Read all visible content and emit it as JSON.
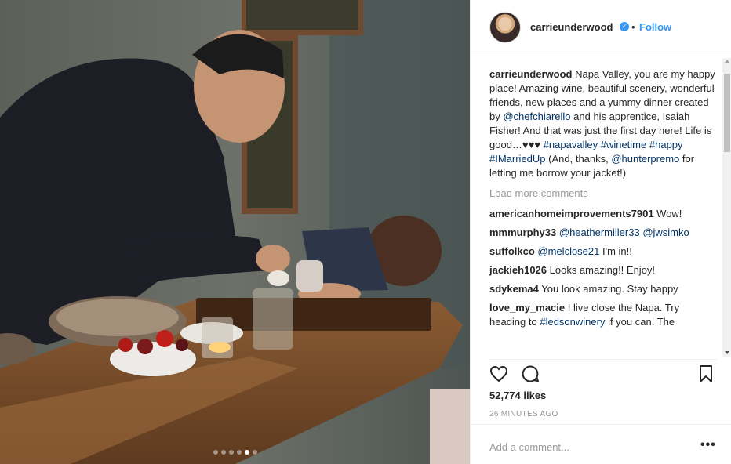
{
  "post": {
    "username": "carrieunderwood",
    "follow_label": "Follow",
    "bullet": "•",
    "verified_icon": "✓",
    "likes": "52,774 likes",
    "time": "26 MINUTES AGO",
    "add_comment_placeholder": "Add a comment...",
    "more_label": "•••",
    "carousel": {
      "count": 6,
      "active_index": 4
    }
  },
  "caption": {
    "user": "carrieunderwood",
    "t1": " Napa Valley, you are my happy place! Amazing wine, beautiful scenery, wonderful friends, new places and a yummy dinner created by ",
    "m1": "@chefchiarello",
    "t2": " and his apprentice, Isaiah Fisher! And that was just the first day here! Life is good…♥♥♥ ",
    "h1": "#napavalley",
    "s1": " ",
    "h2": "#winetime",
    "s2": " ",
    "h3": "#happy",
    "s3": " ",
    "h4": "#IMarriedUp",
    "t3": " (And, thanks, ",
    "m2": "@hunterpremo",
    "t4": " for letting me borrow your jacket!)"
  },
  "load_more": "Load more comments",
  "comments": [
    {
      "user": "americanhomeimprovements7901",
      "text": " Wow!"
    },
    {
      "user": "mmmurphy33",
      "text": " ",
      "mention1": "@heathermiller33",
      "sep": " ",
      "mention2": "@jwsimko"
    },
    {
      "user": "suffolkco",
      "text": " ",
      "mention1": "@melclose21",
      "tail": " I'm in!!"
    },
    {
      "user": "jackieh1026",
      "text": " Looks amazing!! Enjoy!"
    },
    {
      "user": "sdykema4",
      "text": " You look amazing. Stay happy"
    },
    {
      "user": "love_my_macie",
      "text": " I live close the Napa. Try heading to ",
      "mention1": "#ledsonwinery",
      "tail": " if you can. The"
    }
  ],
  "colors": {
    "link": "#003569",
    "follow": "#3897f0",
    "muted": "#999999"
  }
}
